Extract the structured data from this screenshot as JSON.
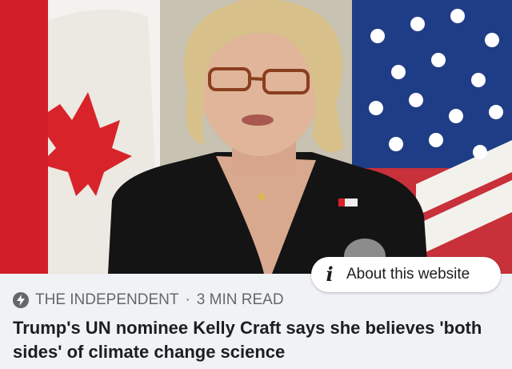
{
  "link_preview": {
    "image_alt": "Kelly Craft speaking in front of Canadian and American flags",
    "about_website_label": "About this website",
    "info_icon": "i",
    "source_name": "THE INDEPENDENT",
    "separator": "·",
    "read_time": "3 MIN READ",
    "headline": "Trump's UN nominee Kelly Craft says she believes 'both sides' of climate change science"
  },
  "colors": {
    "background": "#f0f2f5",
    "headline_text": "#1c1e21",
    "meta_text": "#65676b",
    "pill_background": "#ffffff"
  }
}
